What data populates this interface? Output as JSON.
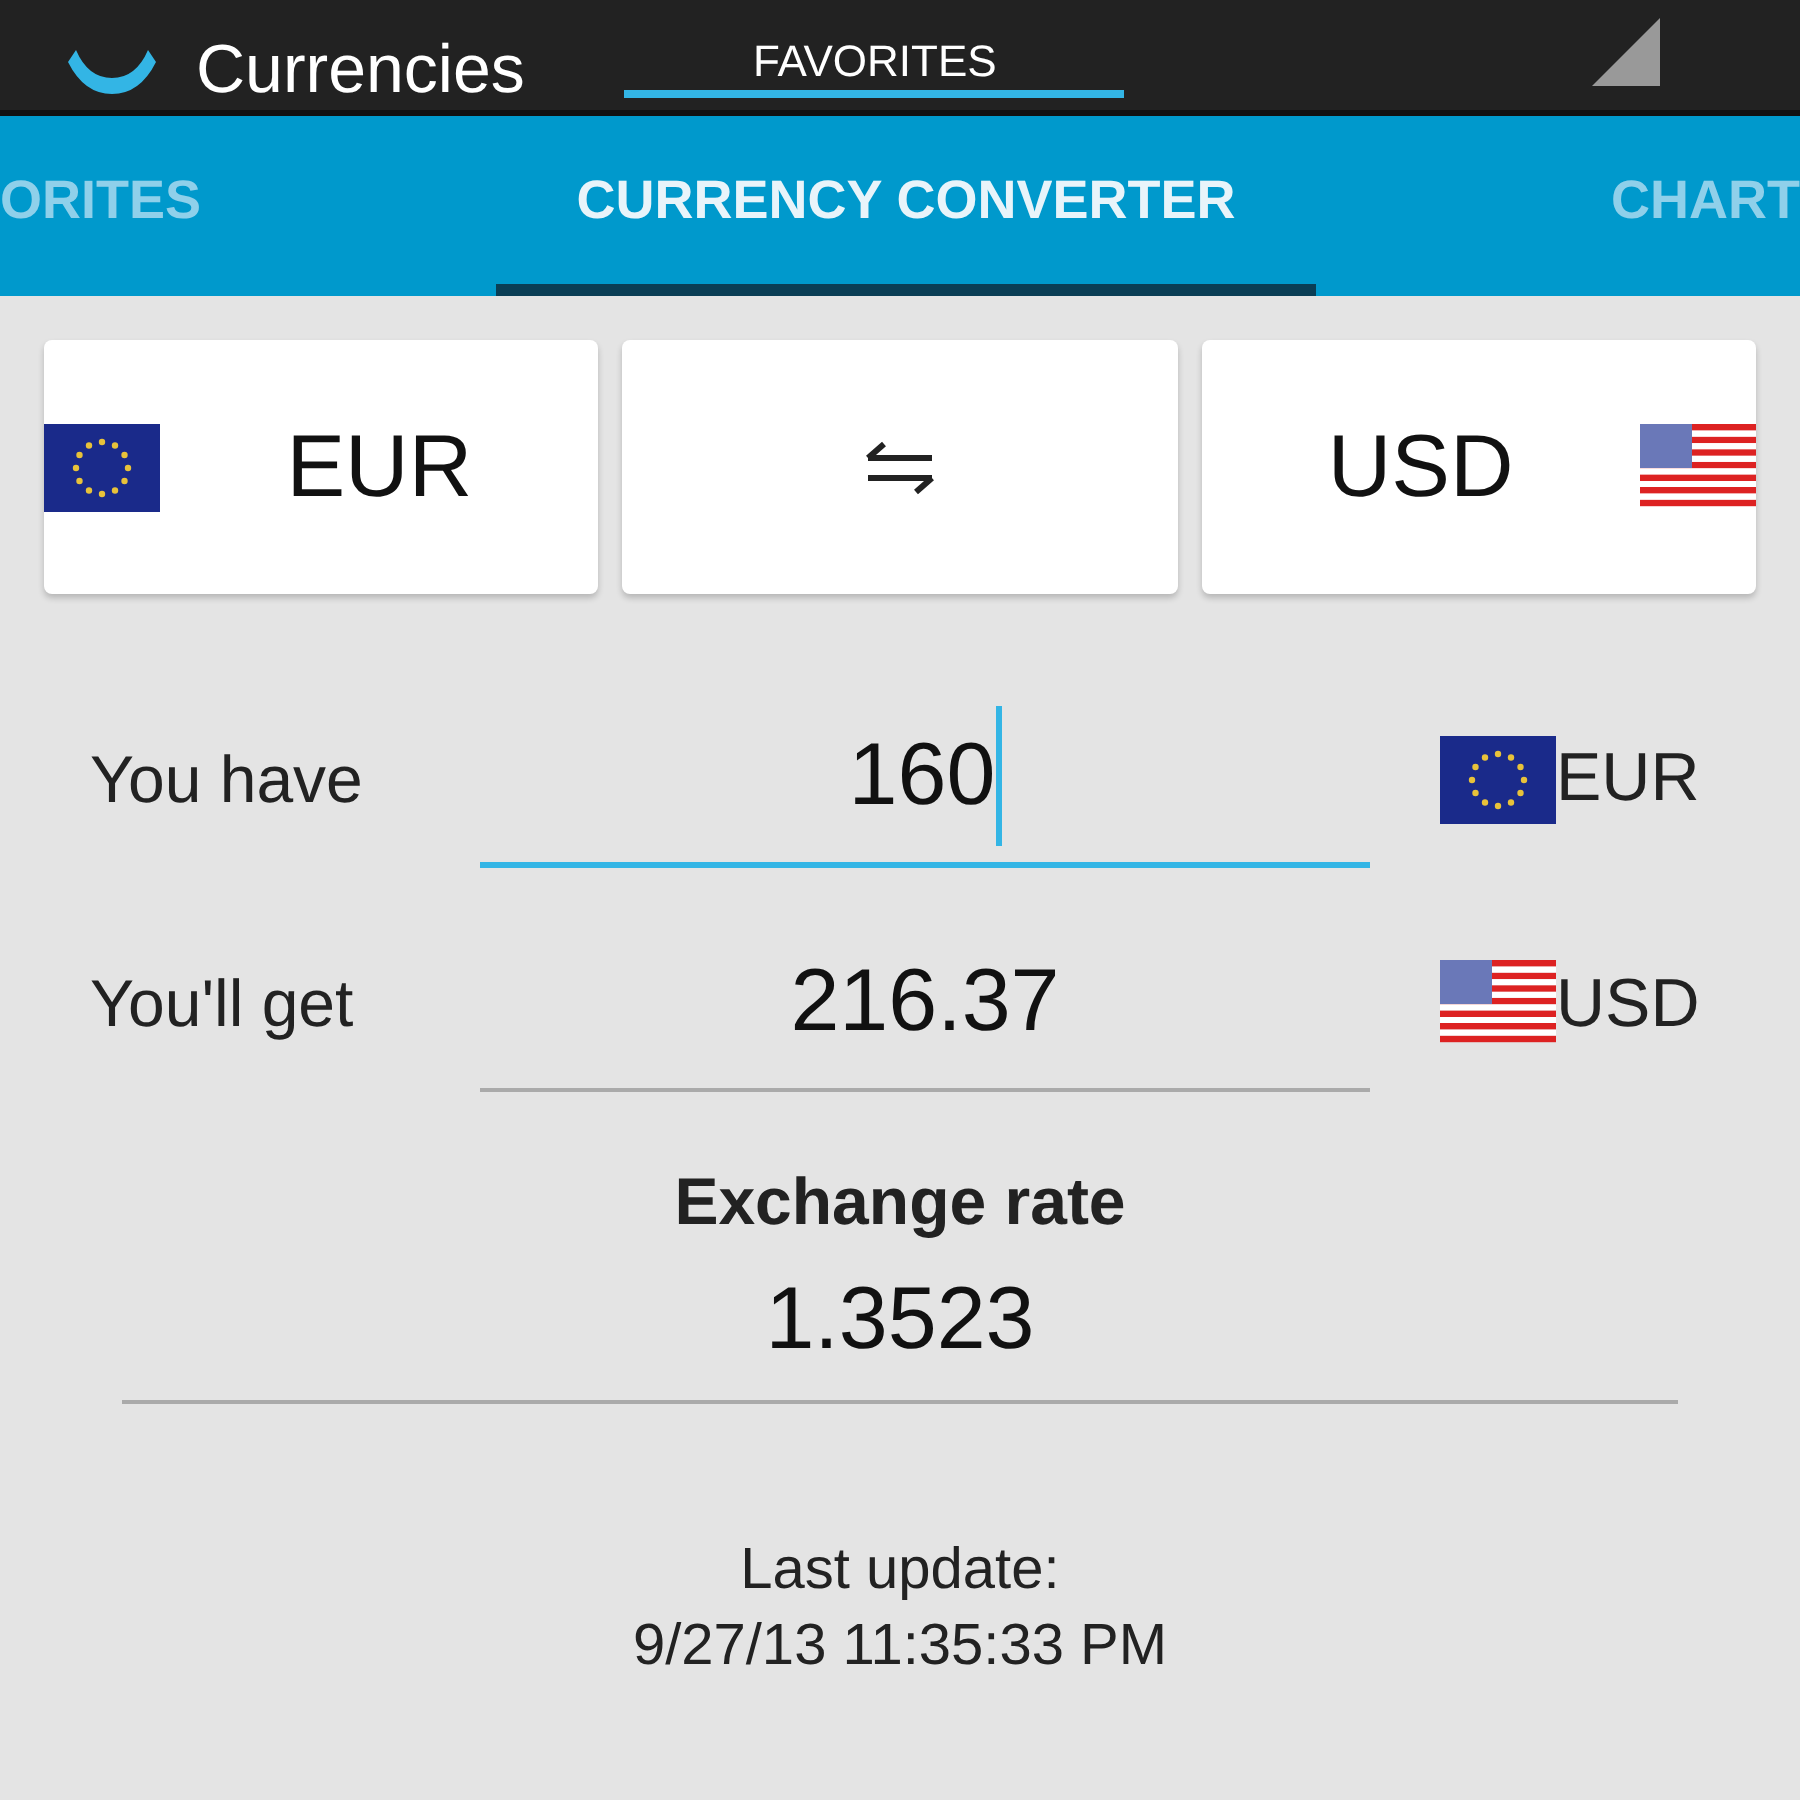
{
  "action_bar": {
    "title": "Currencies",
    "spinner": "FAVORITES"
  },
  "tabs": [
    {
      "label": "ORITES",
      "selected": false
    },
    {
      "label": "CURRENCY CONVERTER",
      "selected": true
    },
    {
      "label": "CHART",
      "selected": false
    }
  ],
  "pair": [
    {
      "code": "EUR",
      "kind": "eu"
    },
    {
      "code": "USD",
      "kind": "us"
    }
  ],
  "rows": [
    {
      "label": "You have",
      "value": "160",
      "focused": true,
      "currency": "EUR",
      "kind": "eu"
    },
    {
      "label": "You'll get",
      "value": "216.37",
      "focused": false,
      "currency": "USD",
      "kind": "us"
    }
  ],
  "exchange": {
    "title": "Exchange rate",
    "value": "1.3523"
  },
  "last_update": {
    "label": "Last update:",
    "time": "9/27/13 11:35:33 PM"
  }
}
